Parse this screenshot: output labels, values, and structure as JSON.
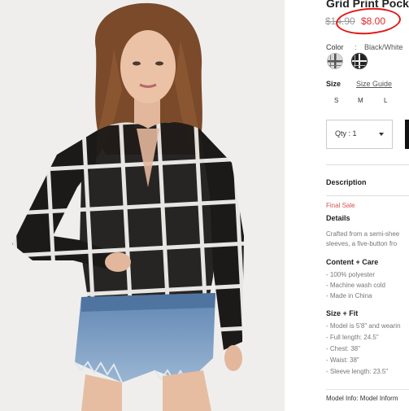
{
  "product": {
    "title": "Grid Print Pock",
    "price_original": "$14.90",
    "price_sale": "$8.00",
    "image_alt": "Model wearing sheer black grid print shirt with denim shorts"
  },
  "color": {
    "label": "Color",
    "separator": ":",
    "value": "Black/White",
    "swatches": [
      {
        "name": "grid-light",
        "color": "#9a9a9a"
      },
      {
        "name": "grid-dark",
        "color": "#222222"
      }
    ]
  },
  "size": {
    "label": "Size",
    "guide_label": "Size Guide",
    "options": [
      "S",
      "M",
      "L"
    ]
  },
  "quantity": {
    "label": "Qty : 1"
  },
  "description": {
    "heading": "Description",
    "final_sale": "Final Sale",
    "details_heading": "Details",
    "details_line1": "Crafted from a semi-shee",
    "details_line2": "sleeves, a five-button fro",
    "content_heading": "Content + Care",
    "content_items": [
      "- 100% polyester",
      "- Machine wash cold",
      "- Made in China"
    ],
    "size_fit_heading": "Size + Fit",
    "size_fit_items": [
      "- Model is 5'8\" and wearin",
      "- Full length: 24.5\"",
      "- Chest: 38\"",
      "- Waist: 38\"",
      "- Sleeve length: 23.5\""
    ],
    "model_info": "Model Info: Model Inform"
  },
  "colors": {
    "sale_red": "#e02b2b",
    "annotation_red": "#e01818",
    "accent_black": "#111111"
  }
}
